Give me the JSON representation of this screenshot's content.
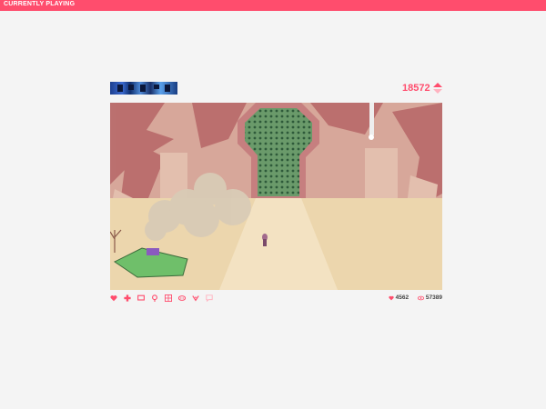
{
  "header": {
    "title": "CURRENTLY PLAYING"
  },
  "game": {
    "score": "18572",
    "score_icon": "score-arrow-icon",
    "colors": {
      "accent": "#ff4d6d",
      "background": "#f4f4f4"
    }
  },
  "toolbar": {
    "icons": [
      "heart-icon",
      "plus-icon",
      "screen-icon",
      "pin-icon",
      "grid-icon",
      "gamepad-icon",
      "arrow-icon",
      "comment-icon"
    ]
  },
  "stats": {
    "likes": "4562",
    "views": "57389"
  }
}
